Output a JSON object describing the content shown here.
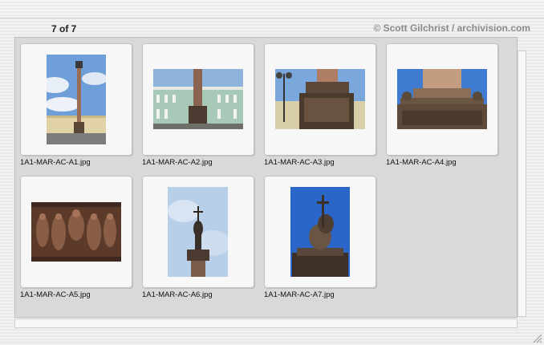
{
  "header": {
    "count_text": "7 of 7",
    "credit_text": "© Scott Gilchrist / archivision.com"
  },
  "thumbnails": [
    {
      "file": "1A1-MAR-AC-A1.jpg",
      "icon": "alexander-column-full-photo"
    },
    {
      "file": "1A1-MAR-AC-A2.jpg",
      "icon": "column-with-winter-palace-photo"
    },
    {
      "file": "1A1-MAR-AC-A3.jpg",
      "icon": "column-pedestal-with-lamp-photo"
    },
    {
      "file": "1A1-MAR-AC-A4.jpg",
      "icon": "column-base-detail-photo"
    },
    {
      "file": "1A1-MAR-AC-A5.jpg",
      "icon": "bronze-relief-panel-photo"
    },
    {
      "file": "1A1-MAR-AC-A6.jpg",
      "icon": "angel-statue-top-photo"
    },
    {
      "file": "1A1-MAR-AC-A7.jpg",
      "icon": "angel-statue-closeup-photo"
    }
  ]
}
